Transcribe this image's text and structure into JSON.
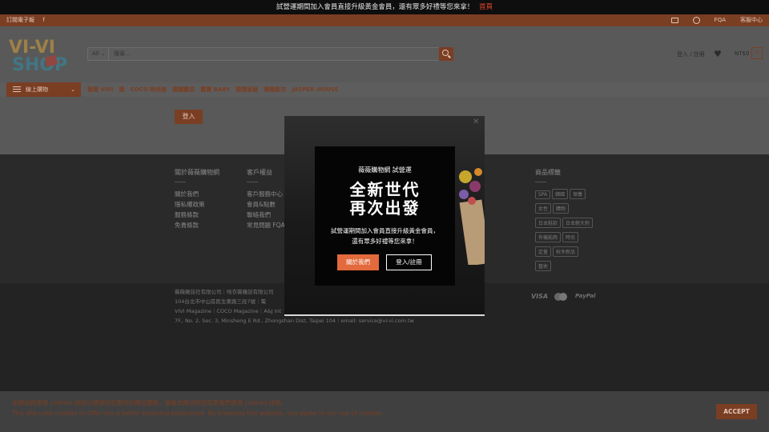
{
  "announcement": {
    "text": "試營運期間加入會員直接升級黃金會員，還有眾多好禮等您來拿！",
    "link": "首頁"
  },
  "topbar": {
    "subscribe": "訂閱電子報",
    "facebook_icon": "f",
    "faq": "FQA",
    "service": "客服中心"
  },
  "header": {
    "logo_line1": "VI-VI",
    "logo_line2": "SHOP",
    "search": {
      "category": "All",
      "placeholder": "搜尋..."
    },
    "account": "登入 / 註冊",
    "cart_total": "NT$0",
    "cart_count": "0"
  },
  "nav": {
    "menu_label": "線上購物",
    "links": [
      "薇薇 VIVI",
      "婕",
      "COCO 時尚族",
      "嬌媚醫芸",
      "寶寶 BABY",
      "微微家庭",
      "微微新衣",
      "JASPER HOUSE"
    ]
  },
  "content": {
    "login_button": "登入"
  },
  "footer": {
    "col1": {
      "heading": "關於薇薇購物網",
      "links": [
        "關於我們",
        "隱私權政策",
        "服務條款",
        "免責條款"
      ]
    },
    "col2": {
      "heading": "客戶權益",
      "links": [
        "客戶服務中心",
        "會員&點數",
        "聯絡我們",
        "常見問題 FQA"
      ]
    },
    "col4": {
      "heading": "商品標籤",
      "tags": [
        "SPA",
        "韓國",
        "保養",
        "女性",
        "購物",
        "日本鞋款",
        "日本輕大刺",
        "有機能飾",
        "時尚",
        "定量",
        "秋冬新品",
        "藝術"
      ]
    },
    "copyright_lines": [
      "薇薇雜誌社有限公司｜哈衣薇雜誌有限公司",
      "104台北市中山區民生東路三段7號｜電",
      "VIVI Magazine｜COCO Magazine｜A&J Int",
      "7F., No. 2, Sec. 3, Minsheng E Rd., Zhongshan Dist, Taipei 104｜email: service@vi-vi.com.tw"
    ],
    "payments": [
      "VISA",
      "PayPal"
    ]
  },
  "modal": {
    "subtitle": "薇薇購物網 試營運",
    "title_line1": "全新世代",
    "title_line2": "再次出發",
    "desc_line1": "試營運期間加入會員直接升級黃金會員，",
    "desc_line2": "還有眾多好禮等您來拿！",
    "about_button": "關於我們",
    "login_button": "登入/註冊",
    "close": "✕"
  },
  "cookie": {
    "line1": "本網站將使用 cookies 技術以便提供您更好的網站體驗，當繼本網站時您同意我們使用 cookies 技術。",
    "line2": "This site uses cookies to offer you a better browsing experience. By browsing this website, you agree to our use of cookies.",
    "accept": "ACCEPT"
  }
}
